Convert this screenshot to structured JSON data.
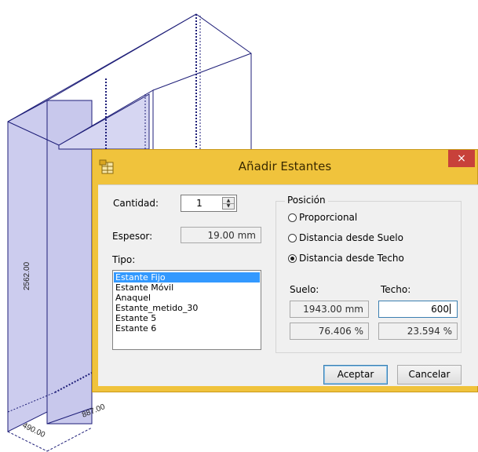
{
  "dimensions": {
    "height": "2562.00",
    "width": "887.00",
    "depth": "490.00"
  },
  "dialog": {
    "title": "Añadir Estantes",
    "close_glyph": "×",
    "app_icon": "shelf-grid-icon",
    "cantidad_label": "Cantidad:",
    "cantidad_value": "1",
    "espesor_label": "Espesor:",
    "espesor_value": "19.00 mm",
    "tipo_label": "Tipo:",
    "tipo_options": [
      "Estante Fijo",
      "Estante Móvil",
      "Anaquel",
      "Estante_metido_30",
      "Estante 5",
      "Estante 6"
    ],
    "tipo_selected": "Estante Fijo",
    "posicion_title": "Posición",
    "radio_options": [
      "Proporcional",
      "Distancia desde Suelo",
      "Distancia desde Techo"
    ],
    "radio_selected": "Distancia desde Techo",
    "suelo_label": "Suelo:",
    "techo_label": "Techo:",
    "suelo_mm": "1943.00 mm",
    "techo_value": "600",
    "suelo_pct": "76.406 %",
    "techo_pct": "23.594 %",
    "accept_label": "Aceptar",
    "cancel_label": "Cancelar"
  },
  "colors": {
    "title_bar": "#f0c33c",
    "panel_fill": "#ccccee",
    "edge": "#1e1e78",
    "selection": "#3399ff"
  }
}
